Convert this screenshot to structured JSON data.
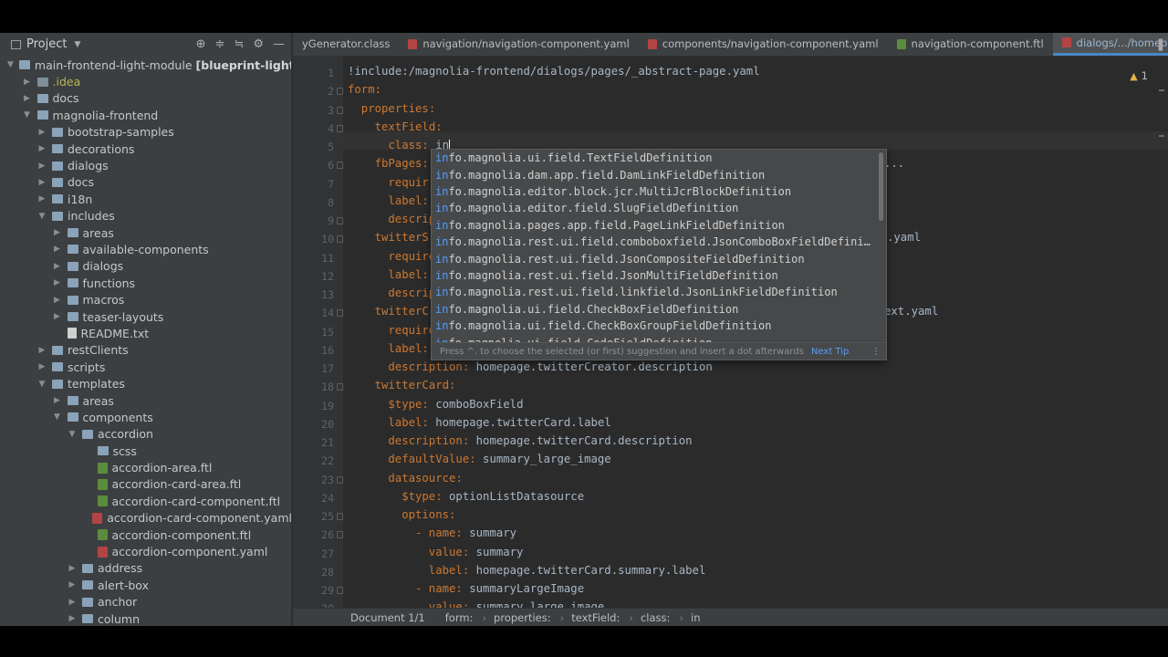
{
  "project_panel": {
    "title": "Project",
    "tree": [
      {
        "label": "main-frontend-light-module",
        "suffix": "[blueprint-light-m",
        "level": 0,
        "arrow": "down",
        "icon": "folder"
      },
      {
        "label": ".idea",
        "level": 1,
        "arrow": "right",
        "icon": "folder-idea",
        "style": "olive"
      },
      {
        "label": "docs",
        "level": 1,
        "arrow": "right",
        "icon": "folder"
      },
      {
        "label": "magnolia-frontend",
        "level": 1,
        "arrow": "down",
        "icon": "folder"
      },
      {
        "label": "bootstrap-samples",
        "level": 2,
        "arrow": "right",
        "icon": "folder"
      },
      {
        "label": "decorations",
        "level": 2,
        "arrow": "right",
        "icon": "folder"
      },
      {
        "label": "dialogs",
        "level": 2,
        "arrow": "right",
        "icon": "folder"
      },
      {
        "label": "docs",
        "level": 2,
        "arrow": "right",
        "icon": "folder"
      },
      {
        "label": "i18n",
        "level": 2,
        "arrow": "right",
        "icon": "folder"
      },
      {
        "label": "includes",
        "level": 2,
        "arrow": "down",
        "icon": "folder"
      },
      {
        "label": "areas",
        "level": 3,
        "arrow": "right",
        "icon": "folder"
      },
      {
        "label": "available-components",
        "level": 3,
        "arrow": "right",
        "icon": "folder"
      },
      {
        "label": "dialogs",
        "level": 3,
        "arrow": "right",
        "icon": "folder"
      },
      {
        "label": "functions",
        "level": 3,
        "arrow": "right",
        "icon": "folder"
      },
      {
        "label": "macros",
        "level": 3,
        "arrow": "right",
        "icon": "folder"
      },
      {
        "label": "teaser-layouts",
        "level": 3,
        "arrow": "right",
        "icon": "folder"
      },
      {
        "label": "README.txt",
        "level": 3,
        "arrow": "",
        "icon": "file-txt"
      },
      {
        "label": "restClients",
        "level": 2,
        "arrow": "right",
        "icon": "folder"
      },
      {
        "label": "scripts",
        "level": 2,
        "arrow": "right",
        "icon": "folder"
      },
      {
        "label": "templates",
        "level": 2,
        "arrow": "down",
        "icon": "folder"
      },
      {
        "label": "areas",
        "level": 3,
        "arrow": "right",
        "icon": "folder"
      },
      {
        "label": "components",
        "level": 3,
        "arrow": "down",
        "icon": "folder"
      },
      {
        "label": "accordion",
        "level": 4,
        "arrow": "down",
        "icon": "folder"
      },
      {
        "label": "scss",
        "level": 5,
        "arrow": "",
        "icon": "folder"
      },
      {
        "label": "accordion-area.ftl",
        "level": 5,
        "arrow": "",
        "icon": "file-ftl"
      },
      {
        "label": "accordion-card-area.ftl",
        "level": 5,
        "arrow": "",
        "icon": "file-ftl"
      },
      {
        "label": "accordion-card-component.ftl",
        "level": 5,
        "arrow": "",
        "icon": "file-ftl"
      },
      {
        "label": "accordion-card-component.yaml",
        "level": 5,
        "arrow": "",
        "icon": "file-yaml"
      },
      {
        "label": "accordion-component.ftl",
        "level": 5,
        "arrow": "",
        "icon": "file-ftl"
      },
      {
        "label": "accordion-component.yaml",
        "level": 5,
        "arrow": "",
        "icon": "file-yaml"
      },
      {
        "label": "address",
        "level": 4,
        "arrow": "right",
        "icon": "folder"
      },
      {
        "label": "alert-box",
        "level": 4,
        "arrow": "right",
        "icon": "folder"
      },
      {
        "label": "anchor",
        "level": 4,
        "arrow": "right",
        "icon": "folder"
      },
      {
        "label": "column",
        "level": 4,
        "arrow": "right",
        "icon": "folder"
      }
    ]
  },
  "tabs": [
    {
      "label": "yGenerator.class",
      "icon": "none",
      "active": false
    },
    {
      "label": "navigation/navigation-component.yaml",
      "icon": "file-yaml",
      "active": false
    },
    {
      "label": "components/navigation-component.yaml",
      "icon": "file-yaml",
      "active": false
    },
    {
      "label": "navigation-component.ftl",
      "icon": "file-ftl",
      "active": false
    },
    {
      "label": "dialogs/.../homepage.yaml",
      "icon": "file-yaml",
      "active": true
    }
  ],
  "editor": {
    "warning_count": "1",
    "lines": [
      {
        "n": "1",
        "indent": 0,
        "key": "",
        "text": "!include:/magnolia-frontend/dialogs/pages/_abstract-page.yaml"
      },
      {
        "n": "2",
        "indent": 0,
        "key": "form",
        "text": ""
      },
      {
        "n": "3",
        "indent": 1,
        "key": "properties",
        "text": ""
      },
      {
        "n": "4",
        "indent": 2,
        "key": "textField",
        "text": ""
      },
      {
        "n": "5",
        "indent": 3,
        "key": "class",
        "text": "in"
      },
      {
        "n": "6",
        "indent": 2,
        "key": "fbPages",
        "text": ""
      },
      {
        "n": "7",
        "indent": 3,
        "key": "requir",
        "text": ""
      },
      {
        "n": "8",
        "indent": 3,
        "key": "label",
        "text": ""
      },
      {
        "n": "9",
        "indent": 3,
        "key": "descrip",
        "text": ""
      },
      {
        "n": "10",
        "indent": 2,
        "key": "twitterS",
        "text": ""
      },
      {
        "n": "11",
        "indent": 3,
        "key": "require",
        "text": ""
      },
      {
        "n": "12",
        "indent": 3,
        "key": "label",
        "text": ""
      },
      {
        "n": "13",
        "indent": 3,
        "key": "descrip",
        "text": ""
      },
      {
        "n": "14",
        "indent": 2,
        "key": "twitterC",
        "text": ""
      },
      {
        "n": "15",
        "indent": 3,
        "key": "require",
        "text": ""
      },
      {
        "n": "16",
        "indent": 3,
        "key": "label",
        "text": ""
      },
      {
        "n": "17",
        "indent": 3,
        "key": "description",
        "text": "homepage.twitterCreator.description"
      },
      {
        "n": "18",
        "indent": 2,
        "key": "twitterCard",
        "text": ""
      },
      {
        "n": "19",
        "indent": 3,
        "key": "$type",
        "text": "comboBoxField"
      },
      {
        "n": "20",
        "indent": 3,
        "key": "label",
        "text": "homepage.twitterCard.label"
      },
      {
        "n": "21",
        "indent": 3,
        "key": "description",
        "text": "homepage.twitterCard.description"
      },
      {
        "n": "22",
        "indent": 3,
        "key": "defaultValue",
        "text": "summary_large_image"
      },
      {
        "n": "23",
        "indent": 3,
        "key": "datasource",
        "text": ""
      },
      {
        "n": "24",
        "indent": 4,
        "key": "$type",
        "text": "optionListDatasource"
      },
      {
        "n": "25",
        "indent": 4,
        "key": "options",
        "text": ""
      },
      {
        "n": "26",
        "indent": 5,
        "key": "- name",
        "text": "summary"
      },
      {
        "n": "27",
        "indent": 6,
        "key": "value",
        "text": "summary"
      },
      {
        "n": "28",
        "indent": 6,
        "key": "label",
        "text": "homepage.twitterCard.summary.label"
      },
      {
        "n": "29",
        "indent": 5,
        "key": "- name",
        "text": "summaryLargeImage"
      },
      {
        "n": "30",
        "indent": 6,
        "key": "value",
        "text": "summary_large_image"
      }
    ],
    "overflow_fragments": [
      {
        "line": "6",
        "text": "..."
      },
      {
        "line": "10",
        "text": ".yaml"
      },
      {
        "line": "14",
        "text": "ext.yaml"
      }
    ]
  },
  "completion": {
    "match": "in",
    "suggestions": [
      "info.magnolia.ui.field.TextFieldDefinition",
      "info.magnolia.dam.app.field.DamLinkFieldDefinition",
      "info.magnolia.editor.block.jcr.MultiJcrBlockDefinition",
      "info.magnolia.editor.field.SlugFieldDefinition",
      "info.magnolia.pages.app.field.PageLinkFieldDefinition",
      "info.magnolia.rest.ui.field.comboboxfield.JsonComboBoxFieldDefini…",
      "info.magnolia.rest.ui.field.JsonCompositeFieldDefinition",
      "info.magnolia.rest.ui.field.JsonMultiFieldDefinition",
      "info.magnolia.rest.ui.field.linkfield.JsonLinkFieldDefinition",
      "info.magnolia.ui.field.CheckBoxFieldDefinition",
      "info.magnolia.ui.field.CheckBoxGroupFieldDefinition",
      "info.magnolia.ui.field.CodeFieldDefinition"
    ],
    "footer_text": "Press ^. to choose the selected (or first) suggestion and insert a dot afterwards",
    "next_tip": "Next Tip"
  },
  "statusbar": {
    "items": [
      "Document 1/1",
      "form:",
      "properties:",
      "textField:",
      "class:",
      "in"
    ]
  },
  "colors": {
    "key": "#cc7832",
    "value": "#a9b7c6",
    "selection": "#2f65ca",
    "match": "#589df6"
  }
}
